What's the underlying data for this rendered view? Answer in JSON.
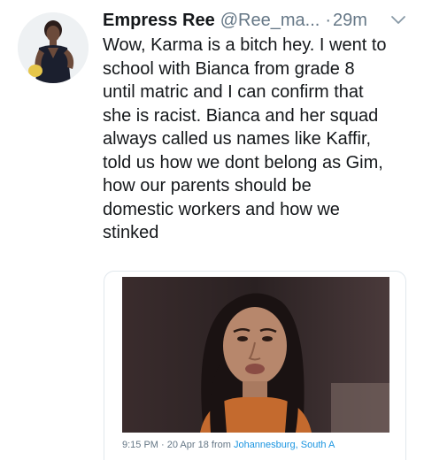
{
  "tweet": {
    "display_name": "Empress Ree",
    "handle": "@Ree_ma...",
    "separator": "·",
    "time": "29m",
    "text": "Wow, Karma is a bitch hey. I went to\nschool with Bianca from grade 8\nuntil matric and I can confirm that\nshe is racist. Bianca and her squad\nalways called us names like Kaffir,\ntold us how we dont belong as Gim,\nhow our parents should be\ndomestic workers and how we\nstinked"
  },
  "media": {
    "timestamp": "9:15 PM · 20 Apr 18 from",
    "location": "Johannesburg, South A"
  },
  "icons": {
    "menu": "chevron-down-icon"
  },
  "colors": {
    "text": "#14171a",
    "muted": "#657786",
    "link": "#1b95e0",
    "border": "#e1e8ed"
  }
}
